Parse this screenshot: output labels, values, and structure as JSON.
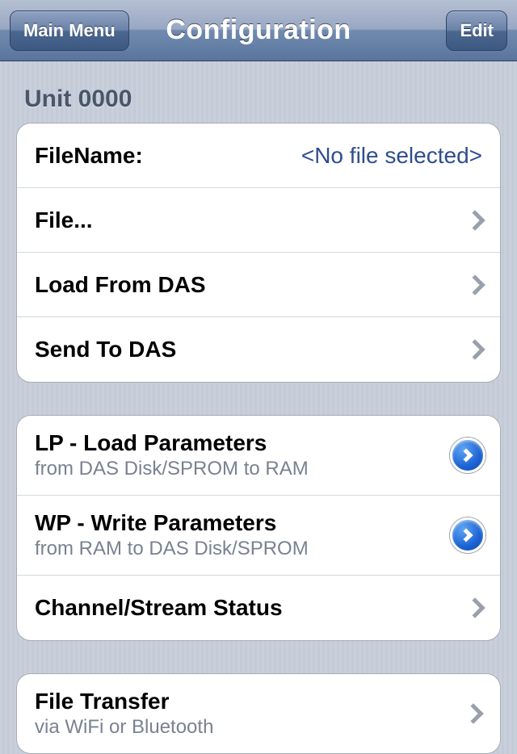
{
  "nav": {
    "back_label": "Main Menu",
    "title": "Configuration",
    "edit_label": "Edit"
  },
  "section_header": "Unit 0000",
  "group1": {
    "filename_label": "FileName:",
    "filename_value": "<No file selected>",
    "file_label": "File...",
    "load_from_das_label": "Load From DAS",
    "send_to_das_label": "Send To DAS"
  },
  "group2": {
    "lp_title": "LP - Load Parameters",
    "lp_sub": "from DAS Disk/SPROM to RAM",
    "wp_title": "WP - Write Parameters",
    "wp_sub": "from RAM to DAS Disk/SPROM",
    "channel_status_label": "Channel/Stream Status"
  },
  "group3": {
    "ft_title": "File Transfer",
    "ft_sub": "via WiFi or Bluetooth"
  }
}
